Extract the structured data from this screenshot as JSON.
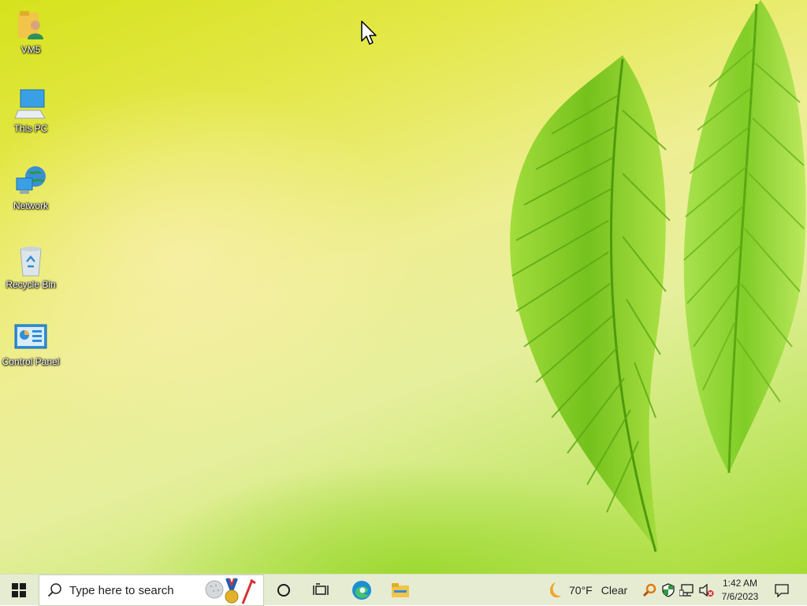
{
  "desktop": {
    "icons": [
      {
        "label": "VM5",
        "icon": "user-folder-icon"
      },
      {
        "label": "This PC",
        "icon": "computer-icon"
      },
      {
        "label": "Network",
        "icon": "network-icon"
      },
      {
        "label": "Recycle Bin",
        "icon": "recycle-bin-icon"
      },
      {
        "label": "Control Panel",
        "icon": "control-panel-icon"
      }
    ]
  },
  "taskbar": {
    "search_placeholder": "Type here to search",
    "weather": {
      "temp": "70°F",
      "condition": "Clear",
      "icon": "moon-icon"
    },
    "clock": {
      "time": "1:42 AM",
      "date": "7/6/2023"
    },
    "apps": [
      "cortana-icon",
      "task-view-icon",
      "edge-icon",
      "file-explorer-icon"
    ],
    "tray_icons": [
      "search-tool-icon",
      "security-shield-icon",
      "network-status-icon",
      "volume-muted-icon"
    ]
  },
  "colors": {
    "taskbar_bg": "#e6ecd2",
    "leaf_green": "#7fc81e",
    "edge_blue": "#1b8fd6"
  }
}
